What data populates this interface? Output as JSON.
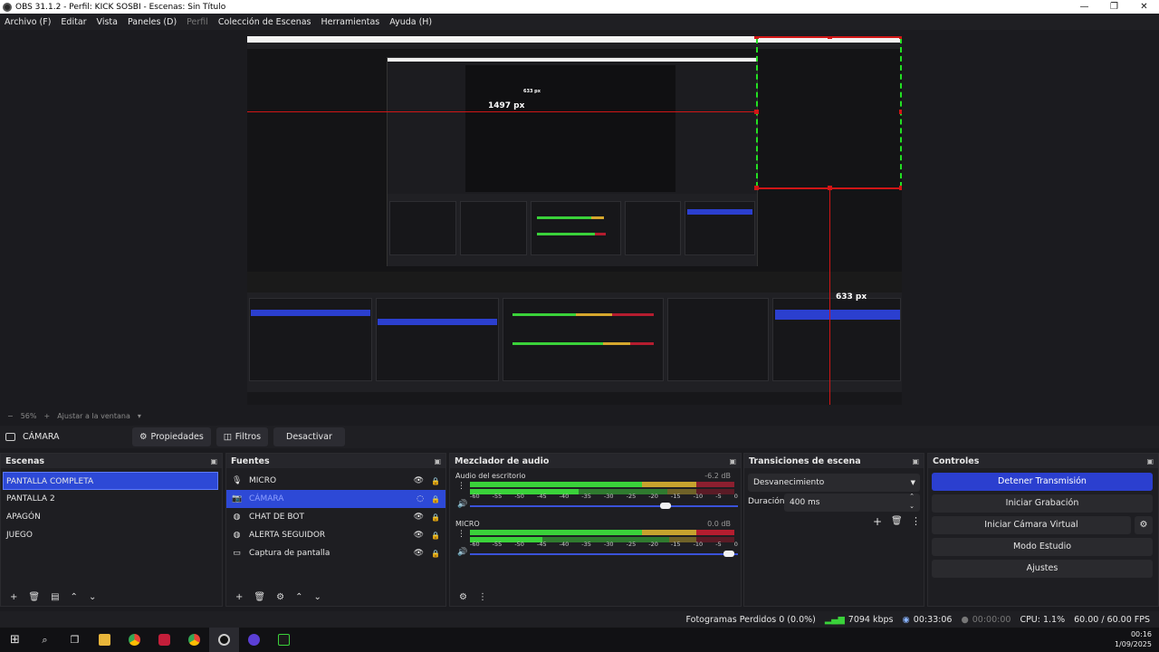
{
  "window": {
    "title": "OBS 31.1.2 - Perfil: KICK SOSBI - Escenas: Sin Título"
  },
  "menu": [
    "Archivo (F)",
    "Editar",
    "Vista",
    "Paneles (D)",
    "Perfil",
    "Colección de Escenas",
    "Herramientas",
    "Ayuda (H)"
  ],
  "preview": {
    "measure_horizontal": "1497 px",
    "measure_vertical_top": "633 px",
    "measure_vertical_bottom": "633 px",
    "accent_red": "#d01616",
    "accent_green": "#23e023"
  },
  "zoom": {
    "minus": "−",
    "level": "56%",
    "plus": "+",
    "fit": "Ajustar a la ventana",
    "caret": "▾"
  },
  "source_toolbar": {
    "selected_source": "CÁMARA",
    "properties": "Propiedades",
    "filters": "Filtros",
    "deactivate": "Desactivar"
  },
  "scenes": {
    "title": "Escenas",
    "items": [
      {
        "label": "PANTALLA COMPLETA",
        "selected": true
      },
      {
        "label": "PANTALLA 2"
      },
      {
        "label": "APAGÓN"
      },
      {
        "label": "JUEGO"
      }
    ]
  },
  "sources": {
    "title": "Fuentes",
    "items": [
      {
        "label": "MICRO",
        "icon": "microphone-icon"
      },
      {
        "label": "CÁMARA",
        "icon": "camera-icon",
        "selected": true
      },
      {
        "label": "CHAT DE BOT",
        "icon": "browser-icon"
      },
      {
        "label": "ALERTA SEGUIDOR",
        "icon": "browser-icon"
      },
      {
        "label": "Captura de pantalla",
        "icon": "monitor-icon"
      }
    ]
  },
  "mixer": {
    "title": "Mezclador de audio",
    "channels": [
      {
        "name": "Audio del escritorio",
        "db": "-6.2 dB",
        "level": 0.72,
        "volume": 0.71
      },
      {
        "name": "MICRO",
        "db": "0.0 dB",
        "level": 0.91,
        "volume": 0.97
      }
    ],
    "ticks": [
      "-60",
      "-55",
      "-50",
      "-45",
      "-40",
      "-35",
      "-30",
      "-25",
      "-20",
      "-15",
      "-10",
      "-5",
      "0"
    ]
  },
  "transitions": {
    "title": "Transiciones de escena",
    "selected": "Desvanecimiento",
    "duration_label": "Duración",
    "duration_value": "400 ms"
  },
  "controls": {
    "title": "Controles",
    "stop_stream": "Detener Transmisión",
    "start_recording": "Iniciar Grabación",
    "start_virtual_cam": "Iniciar Cámara Virtual",
    "studio_mode": "Modo Estudio",
    "settings": "Ajustes"
  },
  "status": {
    "dropped": "Fotogramas Perdidos 0 (0.0%)",
    "bitrate": "7094 kbps",
    "stream_time": "00:33:06",
    "rec_time": "00:00:00",
    "cpu": "CPU: 1.1%",
    "fps": "60.00 / 60.00 FPS"
  },
  "clock": {
    "time": "00:16",
    "date": "1/09/2025"
  }
}
